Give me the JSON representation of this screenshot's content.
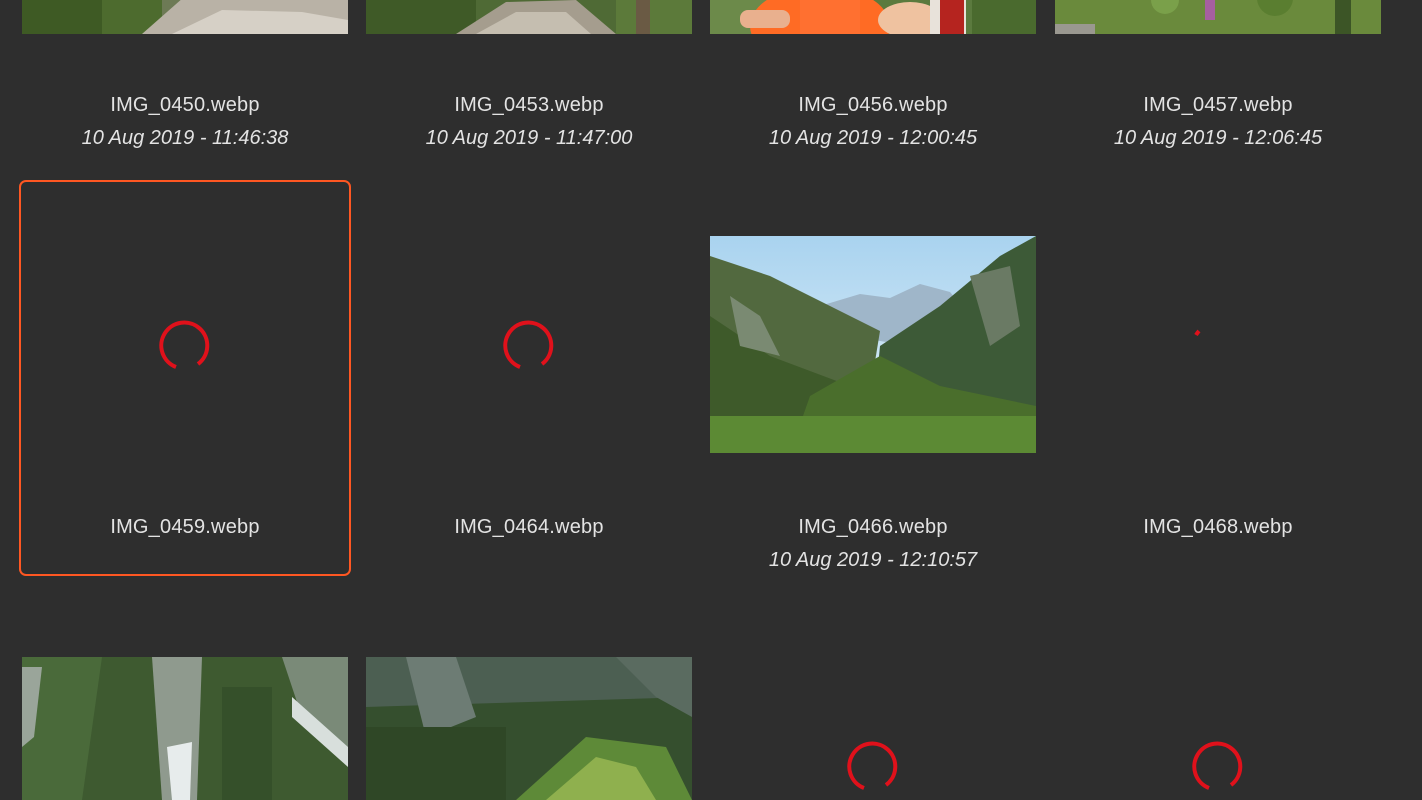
{
  "colors": {
    "background": "#2e2e2e",
    "selection_border": "#ff5722",
    "spinner": "#e0111b",
    "text": "#e3e3e3"
  },
  "items": [
    {
      "filename": "IMG_0450.webp",
      "date": "10 Aug 2019 - 11:46:38",
      "state": "loaded",
      "thumbnail": "rocky-trail-photo"
    },
    {
      "filename": "IMG_0453.webp",
      "date": "10 Aug 2019 - 11:47:00",
      "state": "loaded",
      "thumbnail": "forest-path-photo"
    },
    {
      "filename": "IMG_0456.webp",
      "date": "10 Aug 2019 - 12:00:45",
      "state": "loaded",
      "thumbnail": "hikers-portrait-photo"
    },
    {
      "filename": "IMG_0457.webp",
      "date": "10 Aug 2019 - 12:06:45",
      "state": "loaded",
      "thumbnail": "meadow-flowers-photo"
    },
    {
      "filename": "IMG_0459.webp",
      "date": "",
      "state": "loading",
      "selected": true
    },
    {
      "filename": "IMG_0464.webp",
      "date": "",
      "state": "loading"
    },
    {
      "filename": "IMG_0466.webp",
      "date": "10 Aug 2019 - 12:10:57",
      "state": "loaded",
      "thumbnail": "mountain-valley-photo"
    },
    {
      "filename": "IMG_0468.webp",
      "date": "",
      "state": "loading"
    },
    {
      "filename": "",
      "date": "",
      "state": "loaded",
      "thumbnail": "waterfall-cliff-photo"
    },
    {
      "filename": "",
      "date": "",
      "state": "loaded",
      "thumbnail": "forested-gorge-photo"
    },
    {
      "filename": "",
      "date": "",
      "state": "loading"
    },
    {
      "filename": "",
      "date": "",
      "state": "loading"
    }
  ]
}
